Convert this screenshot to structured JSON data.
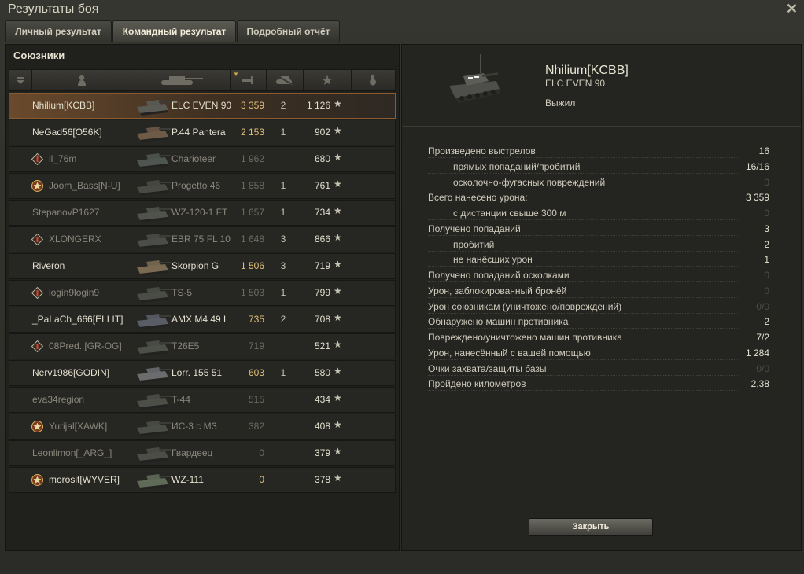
{
  "window": {
    "title": "Результаты боя",
    "close_glyph": "✕"
  },
  "tabs": [
    "Личный результат",
    "Командный результат",
    "Подробный отчёт"
  ],
  "active_tab": 1,
  "allies_label": "Союзники",
  "header_icons": [
    "sort-icon",
    "player-icon",
    "tank-icon",
    "damage-icon",
    "kills-icon",
    "experience-star-icon",
    "medal-icon"
  ],
  "rows": [
    {
      "player": "Nhilium[KCBB]",
      "badge": "",
      "vehicle": "ELC EVEN 90",
      "damage": "3 359",
      "kills": "2",
      "xp": "1 126",
      "alive": true,
      "me": true
    },
    {
      "player": "NeGad56[O56K]",
      "badge": "",
      "vehicle": "P.44 Pantera",
      "damage": "2 153",
      "kills": "1",
      "xp": "902",
      "alive": true,
      "me": false
    },
    {
      "player": "il_76m",
      "badge": "rank-badge",
      "vehicle": "Charioteer",
      "damage": "1 962",
      "kills": "",
      "xp": "680",
      "alive": false,
      "me": false
    },
    {
      "player": "Joom_Bass[N-U]",
      "badge": "clan-emblem",
      "vehicle": "Progetto 46",
      "damage": "1 858",
      "kills": "1",
      "xp": "761",
      "alive": false,
      "me": false
    },
    {
      "player": "StepanovP1627",
      "badge": "",
      "vehicle": "WZ-120-1 FT",
      "damage": "1 657",
      "kills": "1",
      "xp": "734",
      "alive": false,
      "me": false
    },
    {
      "player": "XLONGERX",
      "badge": "rank-badge",
      "vehicle": "EBR 75 FL 10",
      "damage": "1 648",
      "kills": "3",
      "xp": "866",
      "alive": false,
      "me": false
    },
    {
      "player": "Riveron",
      "badge": "",
      "vehicle": "Skorpion G",
      "damage": "1 506",
      "kills": "3",
      "xp": "719",
      "alive": true,
      "me": false
    },
    {
      "player": "login9login9",
      "badge": "rank-badge",
      "vehicle": "TS-5",
      "damage": "1 503",
      "kills": "1",
      "xp": "799",
      "alive": false,
      "me": false
    },
    {
      "player": "_PaLaCh_666[ELLIT]",
      "badge": "",
      "vehicle": "AMX M4 49 L",
      "damage": "735",
      "kills": "2",
      "xp": "708",
      "alive": true,
      "me": false
    },
    {
      "player": "08Pred..[GR-OG]",
      "badge": "rank-badge",
      "vehicle": "T26E5",
      "damage": "719",
      "kills": "",
      "xp": "521",
      "alive": false,
      "me": false
    },
    {
      "player": "Nerv1986[GODIN]",
      "badge": "",
      "vehicle": "Lorr. 155 51",
      "damage": "603",
      "kills": "1",
      "xp": "580",
      "alive": true,
      "me": false
    },
    {
      "player": "eva34region",
      "badge": "",
      "vehicle": "T-44",
      "damage": "515",
      "kills": "",
      "xp": "434",
      "alive": false,
      "me": false
    },
    {
      "player": "Yurijal[XAWK]",
      "badge": "clan-emblem",
      "vehicle": "ИС-3 с МЗ",
      "damage": "382",
      "kills": "",
      "xp": "408",
      "alive": false,
      "me": false
    },
    {
      "player": "Leonlimon[_ARG_]",
      "badge": "",
      "vehicle": "Гвардеец",
      "damage": "0",
      "kills": "",
      "xp": "379",
      "alive": false,
      "me": false
    },
    {
      "player": "morosit[WYVER]",
      "badge": "clan-emblem",
      "vehicle": "WZ-111",
      "damage": "0",
      "kills": "",
      "xp": "378",
      "alive": true,
      "me": false
    }
  ],
  "star_glyph": "★",
  "selected": {
    "player": "Nhilium[KCBB]",
    "vehicle": "ELC EVEN 90",
    "status": "Выжил"
  },
  "stats": [
    {
      "label": "Произведено выстрелов",
      "value": "16",
      "sub": false,
      "zero": false
    },
    {
      "label": "прямых попаданий/пробитий",
      "value": "16/16",
      "sub": true,
      "zero": false
    },
    {
      "label": "осколочно-фугасных повреждений",
      "value": "0",
      "sub": true,
      "zero": true
    },
    {
      "label": "Всего нанесено урона:",
      "value": "3 359",
      "sub": false,
      "zero": false
    },
    {
      "label": "с дистанции свыше 300 м",
      "value": "0",
      "sub": true,
      "zero": true
    },
    {
      "label": "Получено попаданий",
      "value": "3",
      "sub": false,
      "zero": false
    },
    {
      "label": "пробитий",
      "value": "2",
      "sub": true,
      "zero": false
    },
    {
      "label": "не нанёсших урон",
      "value": "1",
      "sub": true,
      "zero": false
    },
    {
      "label": "Получено попаданий осколками",
      "value": "0",
      "sub": false,
      "zero": true
    },
    {
      "label": "Урон, заблокированный бронёй",
      "value": "0",
      "sub": false,
      "zero": true
    },
    {
      "label": "Урон союзникам (уничтожено/повреждений)",
      "value": "0/0",
      "sub": false,
      "zero": true
    },
    {
      "label": "Обнаружено машин противника",
      "value": "2",
      "sub": false,
      "zero": false
    },
    {
      "label": "Повреждено/уничтожено машин противника",
      "value": "7/2",
      "sub": false,
      "zero": false
    },
    {
      "label": "Урон, нанесённый с вашей помощью",
      "value": "1 284",
      "sub": false,
      "zero": false
    },
    {
      "label": "Очки захвата/защиты базы",
      "value": "0/0",
      "sub": false,
      "zero": true
    },
    {
      "label": "Пройдено километров",
      "value": "2,38",
      "sub": false,
      "zero": false
    }
  ],
  "close_button": "Закрыть",
  "colors": {
    "accent_gold": "#c9a54a",
    "self_row": "#6a4a2c",
    "alive_text": "#e4e0cf",
    "dead_text": "#8a877c"
  }
}
